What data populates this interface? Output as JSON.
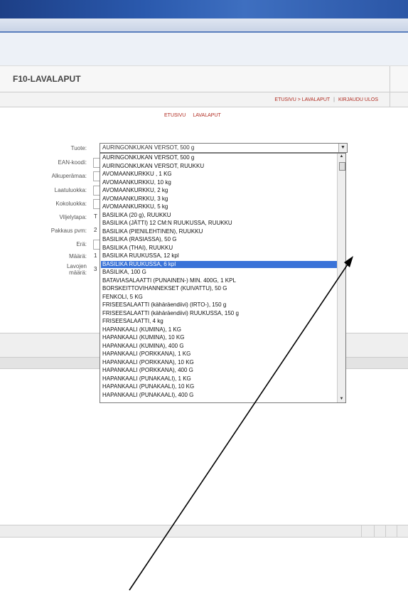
{
  "page_title": "F10-LAVALAPUT",
  "nav": {
    "breadcrumb": "ETUSIVU > LAVALAPUT",
    "separator": "|",
    "logout": "KIRJAUDU ULOS"
  },
  "crumbs": [
    "ETUSIVU",
    "LAVALAPUT"
  ],
  "form": {
    "labels": {
      "tuote": "Tuote:",
      "ean": "EAN-koodi:",
      "alkuperamaa": "Alkuperämaa:",
      "laatuluokka": "Laatuluokka:",
      "kokoluokka": "Kokoluokka:",
      "viljelytapa": "Viljelytapa:",
      "pakkaus": "Pakkaus pvm:",
      "era": "Erä:",
      "maara": "Määrä:",
      "lavojen1": "Lavojen",
      "lavojen2": "määrä:"
    },
    "partial_values": {
      "viljelytapa": "T",
      "pakkaus": "2",
      "maara": "1",
      "lavojen": "3"
    },
    "tuote_selected": "AURINGONKUKAN VERSOT, 500 g",
    "dropdown_options": [
      "AURINGONKUKAN VERSOT, 500 g",
      "AURINGONKUKAN VERSOT, RUUKKU",
      "AVOMAANKURKKU , 1 KG",
      "AVOMAANKURKKU, 10 kg",
      "AVOMAANKURKKU, 2 kg",
      "AVOMAANKURKKU, 3 kg",
      "AVOMAANKURKKU, 5 kg",
      "BASILIKA (20 g), RUUKKU",
      "BASILIKA (JÄTTI) 12 CM:N RUUKUSSA, RUUKKU",
      "BASILIKA (PIENILEHTINEN), RUUKKU",
      "BASILIKA (RASIASSA), 50 G",
      "BASILIKA (THAI), RUUKKU",
      "BASILIKA RUUKUSSA, 12 kpl",
      "BASILIKA RUUKUSSA, 6 kpl",
      "BASILIKA, 100 G",
      "BATAVIASALAATTI (PUNAINEN-) MIN. 400G, 1 KPL",
      "BORSKEITTOVIHANNEKSET (KUIVATTU), 50 G",
      "FENKOLI, 5 KG",
      "FRISEESALAATTI (kähäräendiivi) (IRTO-), 150 g",
      "FRISEESALAATTI (kähäräendiivi) RUUKUSSA, 150 g",
      "FRISEESALAATTI, 4 kg",
      "HAPANKAALI (KUMINA), 1 KG",
      "HAPANKAALI (KUMINA), 10 KG",
      "HAPANKAALI (KUMINA), 400 G",
      "HAPANKAALI (PORKKANA), 1 KG",
      "HAPANKAALI (PORKKANA), 10 KG",
      "HAPANKAALI (PORKKANA), 400 G",
      "HAPANKAALI (PUNAKAALI), 1 KG",
      "HAPANKAALI (PUNAKAALI), 10 KG",
      "HAPANKAALI (PUNAKAALI), 400 G"
    ],
    "highlighted_option": "BASILIKA RUUKUSSA, 6 kpl"
  },
  "colors": {
    "brand_blue": "#2a59ad",
    "link_red": "#b02a1f",
    "highlight": "#3a73d8"
  },
  "icons": {
    "dropdown_arrow": "triangle-down",
    "scroll_up": "triangle-up",
    "scroll_down": "triangle-down"
  }
}
